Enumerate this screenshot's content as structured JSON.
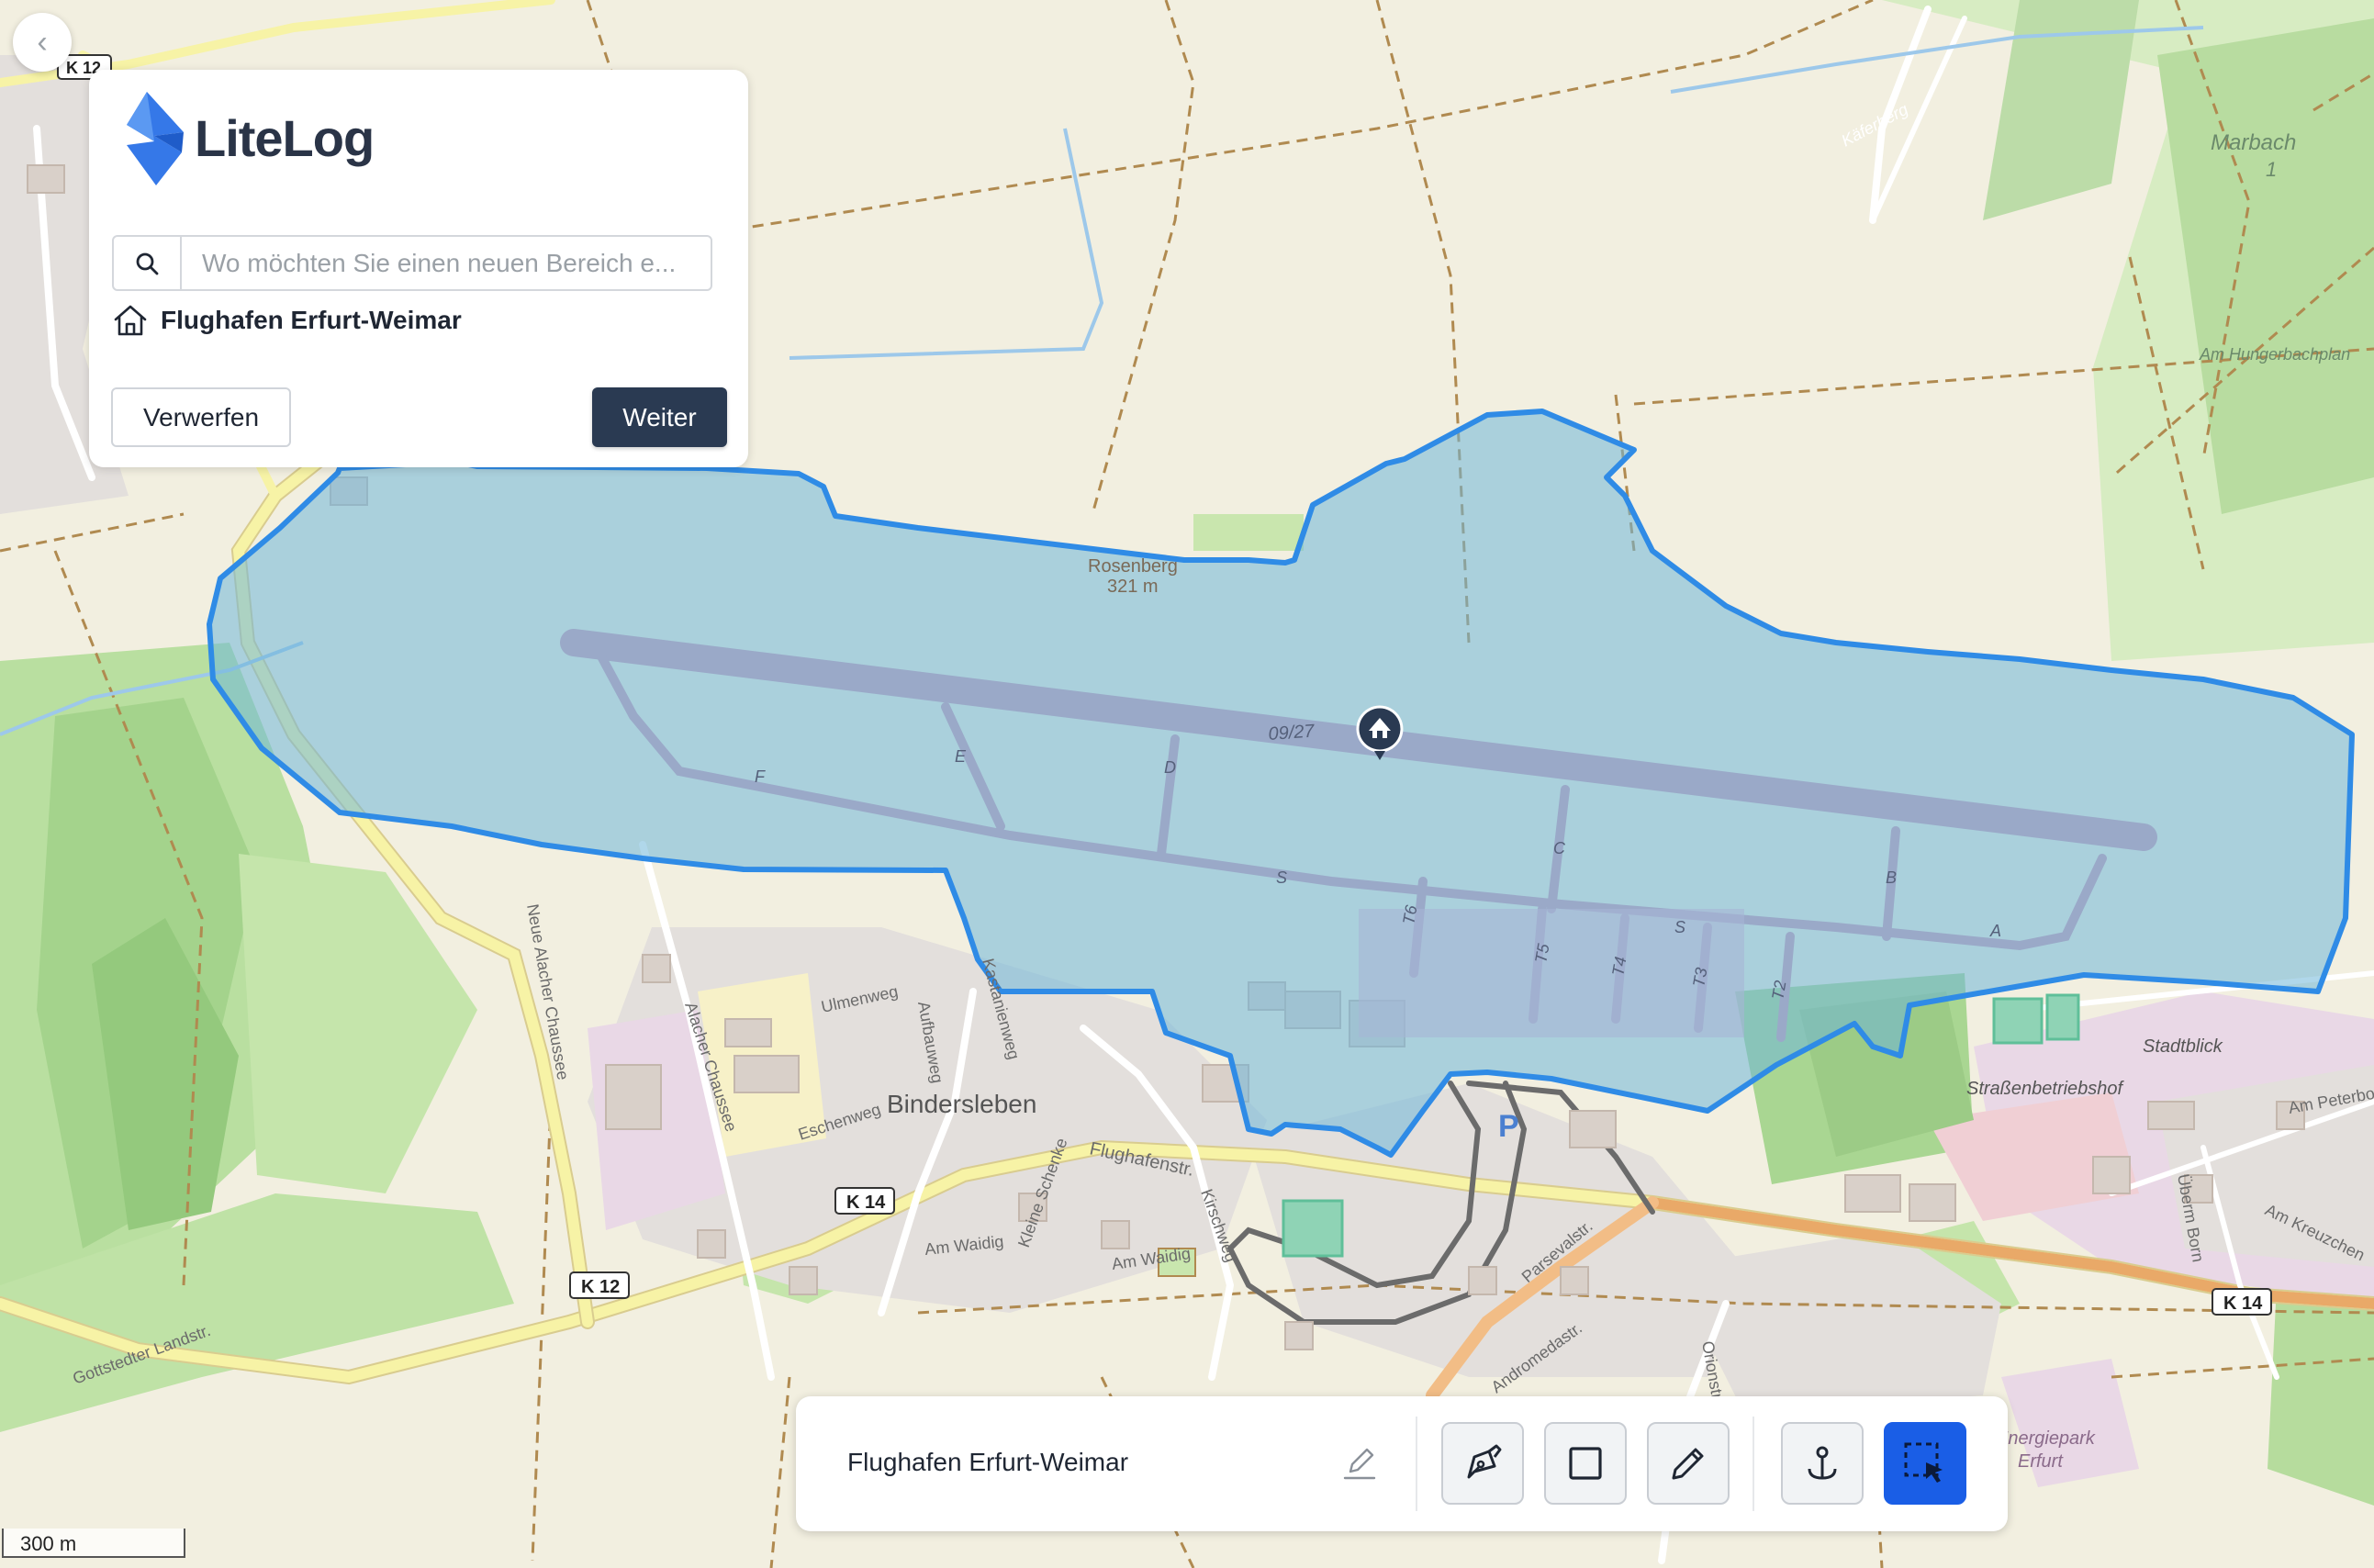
{
  "app": {
    "name": "LiteLog"
  },
  "search": {
    "placeholder": "Wo möchten Sie einen neuen Bereich e...",
    "value": ""
  },
  "selected_place": {
    "label": "Flughafen Erfurt-Weimar"
  },
  "actions": {
    "discard_label": "Verwerfen",
    "next_label": "Weiter"
  },
  "toolbar": {
    "area_name": "Flughafen Erfurt-Weimar",
    "tools": [
      {
        "name": "pen-tool",
        "icon": "pen-nib-icon"
      },
      {
        "name": "rectangle-tool",
        "icon": "square-icon"
      },
      {
        "name": "pencil-tool",
        "icon": "pencil-icon"
      },
      {
        "name": "anchor-tool",
        "icon": "anchor-icon"
      },
      {
        "name": "select-area-tool",
        "icon": "selection-cursor-icon",
        "active": true
      }
    ],
    "active_color": "#1a5ee6"
  },
  "map": {
    "scale_label": "300 m",
    "labels": {
      "rosenberg": "Rosenberg",
      "rosenberg_elev": "321 m",
      "runway": "09/27",
      "bindersleben": "Bindersleben",
      "k14_a": "K 14",
      "k14_b": "K 14",
      "k12_a": "K 12",
      "k12_b": "K 12",
      "marbach": "Marbach",
      "marbach_1": "1",
      "kaferberg": "Käferberg",
      "stadtblick": "Stadtblick",
      "strassenbetriebshof": "Straßenbetriebshof",
      "am_hungerbachplan": "Am Hungerbachplan",
      "ulmenweg": "Ulmenweg",
      "eschenweg": "Eschenweg",
      "am_waidig_a": "Am Waidig",
      "am_waidig_b": "Am Waidig",
      "flughafenstr": "Flughafenstr.",
      "kirschweg": "Kirschweg",
      "alacher_chaussee": "Alacher Chaussee",
      "neue_alacher_chaussee": "Neue Alacher Chaussee",
      "gottstedter": "Gottstedter Landstr.",
      "parsevalstr": "Parsevalstr.",
      "orionstr": "Orionstr.",
      "andromedastr": "Andromedastr.",
      "am_peterborn": "Am Peterbor",
      "am_kreuzchen": "Am Kreuzchen",
      "ubern_born": "Überm Born",
      "energiepark": "Energiepark",
      "energiepark_erfurt": "Erfurt",
      "aufbauweg": "Aufbauweg",
      "kastanienweg": "Kastanienweg",
      "kleine_schenke": "Kleine Schenke",
      "twy_e": "E",
      "twy_f": "F",
      "twy_d": "D",
      "twy_c": "C",
      "twy_b": "B",
      "twy_a": "A",
      "twy_s1": "S",
      "twy_s2": "S",
      "twy_t6": "T6",
      "twy_t5": "T5",
      "twy_t4": "T4",
      "twy_t3": "T3",
      "twy_t2": "T2",
      "parking": "P"
    },
    "colors": {
      "polygon_fill": "#6fb7d8",
      "polygon_stroke": "#2f8be6",
      "runway": "#9aa9c8"
    }
  }
}
